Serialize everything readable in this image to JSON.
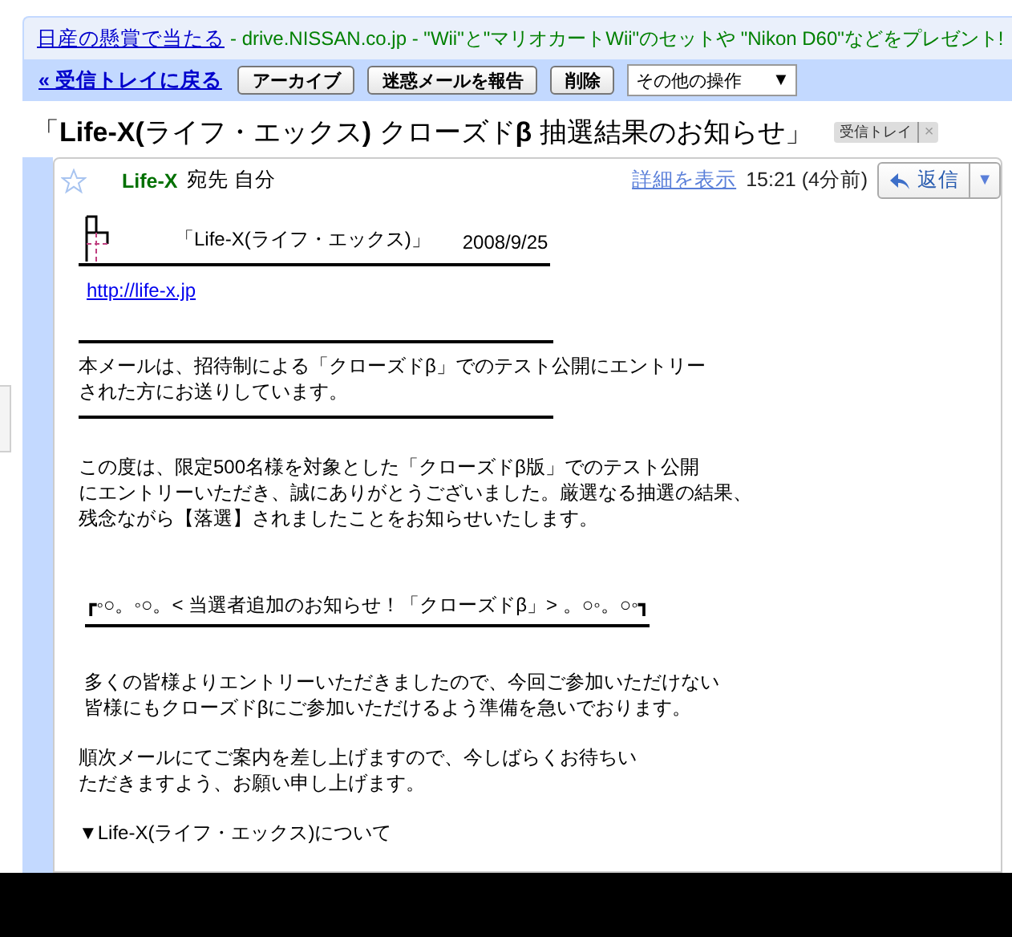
{
  "ad": {
    "link": "日産の懸賞で当たる",
    "text": "- drive.NISSAN.co.jp - \"Wii\"と\"マリオカートWii\"のセットや \"Nikon D60\"などをプレゼント!"
  },
  "toolbar": {
    "back_link": "« 受信トレイに戻る",
    "buttons": [
      "アーカイブ",
      "迷惑メールを報告",
      "削除"
    ],
    "more_actions": "その他の操作",
    "more_arrow": "▼"
  },
  "subject": "「**Life-X(**ライフ・エックス**)** クローズド**β** 抽選結果のお知らせ」",
  "label": {
    "text": "受信トレイ",
    "remove": "×"
  },
  "message": {
    "starred": false,
    "sender": "Life-X",
    "to": "宛先 自分",
    "details_link": "詳細を表示",
    "time": "15:21 (4分前)",
    "reply": "返信",
    "reply_menu": "▼"
  },
  "body": [
    {
      "kind": "header",
      "title": "「Life-X(ライフ・エックス)」",
      "date": "2008/9/25"
    },
    {
      "kind": "link",
      "text": "http://life-x.jp"
    },
    {
      "kind": "rule"
    },
    {
      "kind": "paragraph",
      "lines": [
        "本メールは、招待制による「クローズドβ」でのテスト公開にエントリー",
        "された方にお送りしています。"
      ]
    },
    {
      "kind": "rule"
    },
    {
      "kind": "paragraph",
      "lines": [
        "この度は、限定500名様を対象とした「クローズドβ版」でのテスト公開",
        "にエントリーいただき、誠にありがとうございました。厳選なる抽選の結果、",
        "残念ながら【落選】されましたことをお知らせいたします。"
      ]
    },
    {
      "kind": "banner",
      "text": "┏◦○。◦○。< 当選者追加のお知らせ！「クローズドβ」> 。○◦。○◦┓"
    },
    {
      "kind": "paragraph",
      "lines": [
        " 多くの皆様よりエントリーいただきましたので、今回ご参加いただけない",
        " 皆様にもクローズドβにご参加いただけるよう準備を急いでおります。"
      ]
    },
    {
      "kind": "paragraph",
      "lines": [
        "順次メールにてご案内を差し上げますので、今しばらくお待ちい",
        "ただきますよう、お願い申し上げます。"
      ]
    },
    {
      "kind": "paragraph",
      "lines": [
        "▼Life-X(ライフ・エックス)について"
      ]
    }
  ]
}
